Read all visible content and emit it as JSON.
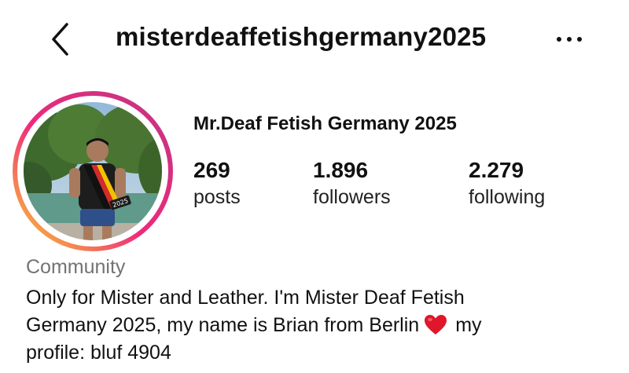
{
  "header": {
    "back_icon": "chevron-left-icon",
    "username": "misterdeaffetishgermany2025",
    "more_icon": "more-horizontal-icon"
  },
  "profile": {
    "display_name": "Mr.Deaf Fetish Germany 2025",
    "avatar_badge_text": "2025",
    "stats": {
      "posts": {
        "value": "269",
        "label": "posts"
      },
      "followers": {
        "value": "1.896",
        "label": "followers"
      },
      "following": {
        "value": "2.279",
        "label": "following"
      }
    },
    "category": "Community",
    "bio": {
      "line1": "Only for Mister and Leather. I'm Mister Deaf Fetish",
      "line2_before": "Germany 2025, my name is Brian from Berlin",
      "line2_after": "my",
      "line3": "profile: bluf 4904",
      "emoji": "red-heart-icon"
    }
  },
  "colors": {
    "ring_start": "#f9ce34",
    "ring_mid": "#ee2a7b",
    "ring_end": "#c13584",
    "text": "#111111",
    "muted": "#737373",
    "heart": "#e0162b"
  }
}
